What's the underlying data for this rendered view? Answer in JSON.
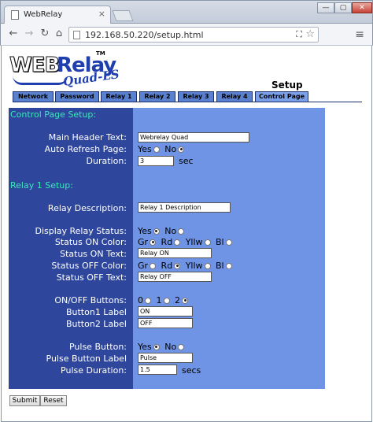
{
  "browser": {
    "tab_title": "WebRelay",
    "url": "192.168.50.220/setup.html",
    "window_controls": [
      "—",
      "▢",
      "✕"
    ]
  },
  "logo": {
    "web": "WEB",
    "relay": "Relay",
    "tm": "TM",
    "sub": "Quad-LS"
  },
  "page_heading": "Setup",
  "nav_tabs": [
    "Network",
    "Password",
    "Relay 1",
    "Relay 2",
    "Relay 3",
    "Relay 4",
    "Control Page"
  ],
  "control_page": {
    "title": "Control Page Setup:",
    "main_header_label": "Main Header Text:",
    "main_header_value": "Webrelay Quad",
    "auto_refresh_label": "Auto Refresh Page:",
    "auto_refresh_selected": "No",
    "duration_label": "Duration:",
    "duration_value": "3",
    "duration_unit": "sec"
  },
  "relay1": {
    "title": "Relay 1 Setup:",
    "description_label": "Relay Description:",
    "description_value": "Relay 1 Description",
    "display_status_label": "Display Relay Status:",
    "display_status_selected": "Yes",
    "status_on_color_label": "Status ON Color:",
    "status_on_color_selected": "Gr",
    "status_on_text_label": "Status ON Text:",
    "status_on_text_value": "Relay ON",
    "status_off_color_label": "Status OFF Color:",
    "status_off_color_selected": "Yllw",
    "status_off_text_label": "Status OFF Text:",
    "status_off_text_value": "Relay OFF",
    "onoff_buttons_label": "ON/OFF Buttons:",
    "onoff_buttons_selected": "2",
    "button1_label": "Button1 Label",
    "button1_value": "ON",
    "button2_label": "Button2 Label",
    "button2_value": "OFF",
    "pulse_button_label": "Pulse Button:",
    "pulse_button_selected": "Yes",
    "pulse_button_text_label": "Pulse Button Label",
    "pulse_button_text_value": "Pulse",
    "pulse_duration_label": "Pulse Duration:",
    "pulse_duration_value": "1.5",
    "pulse_duration_unit": "secs"
  },
  "options": {
    "yes": "Yes",
    "no": "No",
    "gr": "Gr",
    "rd": "Rd",
    "yllw": "Yllw",
    "bl": "Bl",
    "zero": "0",
    "one": "1",
    "two": "2"
  },
  "buttons": {
    "submit": "Submit",
    "reset": "Reset"
  },
  "colors": {
    "left_panel": "#2e479c",
    "right_panel": "#6f93e5",
    "section_title": "#38e8b8",
    "tab": "#5a80d0"
  },
  "icons": [
    "page-icon",
    "close-icon",
    "back-arrow-icon",
    "forward-arrow-icon",
    "reload-icon",
    "home-icon",
    "translate-icon",
    "star-icon",
    "menu-icon"
  ]
}
